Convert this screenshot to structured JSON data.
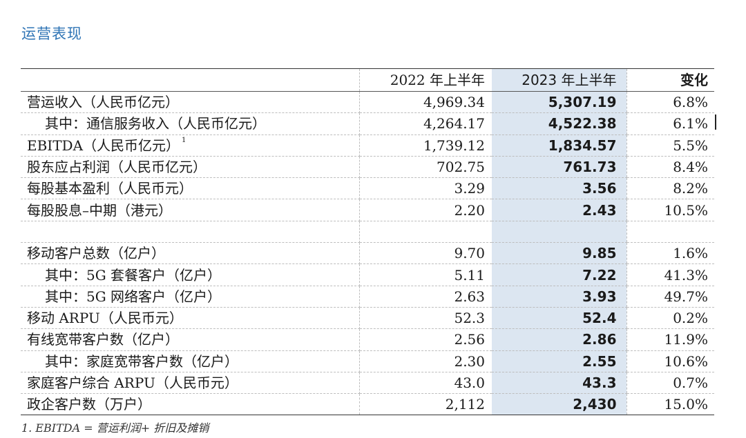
{
  "section_title": "运营表现",
  "table": {
    "headers": {
      "label": "",
      "y2022": "2022 年上半年",
      "y2023": "2023 年上半年",
      "change": "变化"
    },
    "rows": [
      {
        "label": "营运收入（人民币亿元）",
        "footnote": "",
        "y2022": "4,969.34",
        "y2023": "5,307.19",
        "change": "6.8%"
      },
      {
        "label": "其中：通信服务收入（人民币亿元）",
        "footnote": "",
        "y2022": "4,264.17",
        "y2023": "4,522.38",
        "change": "6.1%"
      },
      {
        "label": "EBITDA（人民币亿元）",
        "footnote": "1",
        "y2022": "1,739.12",
        "y2023": "1,834.57",
        "change": "5.5%"
      },
      {
        "label": "股东应占利润（人民币亿元）",
        "footnote": "",
        "y2022": "702.75",
        "y2023": "761.73",
        "change": "8.4%"
      },
      {
        "label": "每股基本盈利（人民币元）",
        "footnote": "",
        "y2022": "3.29",
        "y2023": "3.56",
        "change": "8.2%"
      },
      {
        "label": "每股股息–中期（港元）",
        "footnote": "",
        "y2022": "2.20",
        "y2023": "2.43",
        "change": "10.5%"
      },
      {
        "label": "",
        "footnote": "",
        "y2022": "",
        "y2023": "",
        "change": ""
      },
      {
        "label": "移动客户总数（亿户）",
        "footnote": "",
        "y2022": "9.70",
        "y2023": "9.85",
        "change": "1.6%"
      },
      {
        "label": "其中：5G 套餐客户（亿户）",
        "footnote": "",
        "y2022": "5.11",
        "y2023": "7.22",
        "change": "41.3%"
      },
      {
        "label": "其中：5G 网络客户（亿户）",
        "footnote": "",
        "y2022": "2.63",
        "y2023": "3.93",
        "change": "49.7%"
      },
      {
        "label": "移动 ARPU（人民币元）",
        "footnote": "",
        "y2022": "52.3",
        "y2023": "52.4",
        "change": "0.2%"
      },
      {
        "label": "有线宽带客户数（亿户）",
        "footnote": "",
        "y2022": "2.56",
        "y2023": "2.86",
        "change": "11.9%"
      },
      {
        "label": "其中：家庭宽带客户数（亿户）",
        "footnote": "",
        "y2022": "2.30",
        "y2023": "2.55",
        "change": "10.6%"
      },
      {
        "label": "家庭客户综合 ARPU（人民币元）",
        "footnote": "",
        "y2022": "43.0",
        "y2023": "43.3",
        "change": "0.7%"
      },
      {
        "label": "政企客户数（万户）",
        "footnote": "",
        "y2022": "2,112",
        "y2023": "2,430",
        "change": "15.0%"
      }
    ]
  },
  "footnote": "1.  EBITDA = 营运利润+ 折旧及摊销",
  "colors": {
    "title": "#2f74b5",
    "highlight_column": "#dce6f1"
  }
}
